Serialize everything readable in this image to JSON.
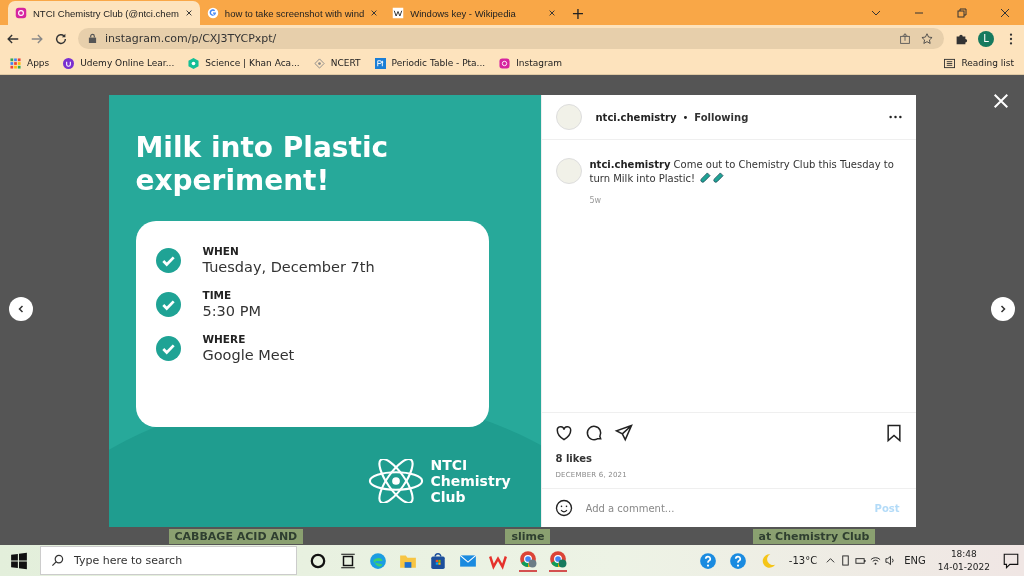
{
  "browser": {
    "tabs": [
      {
        "title": "NTCI Chemistry Club (@ntci.chem",
        "kind": "instagram",
        "selected": true
      },
      {
        "title": "how to take screenshot with wind",
        "kind": "google",
        "selected": false
      },
      {
        "title": "Windows key - Wikipedia",
        "kind": "wikipedia",
        "selected": false
      }
    ],
    "new_tab": "+",
    "url": "instagram.com/p/CXJ3TYCPxpt/",
    "profile_initial": "L",
    "bookmarks": [
      {
        "label": "Apps",
        "kind": "apps"
      },
      {
        "label": "Udemy Online Lear...",
        "kind": "udemy"
      },
      {
        "label": "Science | Khan Aca...",
        "kind": "khan"
      },
      {
        "label": "NCERT",
        "kind": "ncert"
      },
      {
        "label": "Periodic Table - Pta...",
        "kind": "ptable"
      },
      {
        "label": "Instagram",
        "kind": "instagram"
      }
    ],
    "reading_list": "Reading list"
  },
  "post": {
    "image": {
      "title": "Milk into Plastic experiment!",
      "details": [
        {
          "label": "WHEN",
          "value": "Tuesday, December 7th"
        },
        {
          "label": "TIME",
          "value": "5:30 PM"
        },
        {
          "label": "WHERE",
          "value": "Google Meet"
        }
      ],
      "club_lines": [
        "NTCI",
        "Chemistry",
        "Club"
      ]
    },
    "username": "ntci.chemistry",
    "separator": "•",
    "follow_status": "Following",
    "caption": {
      "username": "ntci.chemistry",
      "text": "Come out to Chemistry Club this Tuesday to turn Milk into Plastic!",
      "age": "5w"
    },
    "likes": "8 likes",
    "date": "DECEMBER 6, 2021",
    "comment_placeholder": "Add a comment...",
    "post_button": "Post"
  },
  "background_texts": [
    "CABBAGE ACID AND",
    "slime",
    "at Chemistry Club"
  ],
  "taskbar": {
    "search_placeholder": "Type here to search",
    "temperature": "-13°C",
    "language": "ENG",
    "time": "18:48",
    "date": "14-01-2022"
  }
}
